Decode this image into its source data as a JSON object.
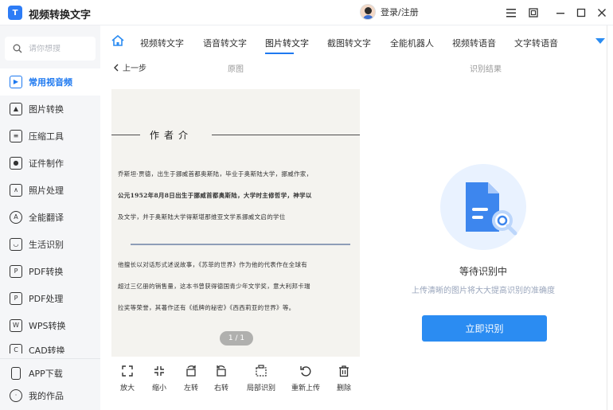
{
  "app": {
    "title": "视频转换文字",
    "logo_text": "T",
    "login_label": "登录/注册"
  },
  "window_controls": [
    "menu-icon",
    "restore-icon",
    "minimize-icon",
    "maximize-icon",
    "close-icon"
  ],
  "sidebar": {
    "search_placeholder": "请你想搜",
    "items": [
      {
        "label": "常用视音频",
        "icon": "tv-icon",
        "active": true
      },
      {
        "label": "图片转换",
        "icon": "image-icon"
      },
      {
        "label": "压缩工具",
        "icon": "compress-icon"
      },
      {
        "label": "证件制作",
        "icon": "id-photo-icon"
      },
      {
        "label": "照片处理",
        "icon": "photo-icon"
      },
      {
        "label": "全能翻译",
        "icon": "translate-icon"
      },
      {
        "label": "生活识别",
        "icon": "cup-icon"
      },
      {
        "label": "PDF转换",
        "icon": "pdf-convert-icon"
      },
      {
        "label": "PDF处理",
        "icon": "pdf-process-icon"
      },
      {
        "label": "WPS转换",
        "icon": "wps-icon"
      },
      {
        "label": "CAD转换",
        "icon": "cad-icon"
      }
    ],
    "bottom": [
      {
        "label": "APP下载",
        "icon": "phone-icon"
      },
      {
        "label": "我的作品",
        "icon": "works-icon"
      }
    ]
  },
  "tabs": [
    {
      "label": "视频转文字"
    },
    {
      "label": "语音转文字"
    },
    {
      "label": "图片转文字",
      "active": true
    },
    {
      "label": "截图转文字"
    },
    {
      "label": "全能机器人"
    },
    {
      "label": "视频转语音"
    },
    {
      "label": "文字转语音"
    }
  ],
  "subheader": {
    "back_label": "上一步",
    "original_label": "原图",
    "result_label": "识别结果"
  },
  "document": {
    "heading": "作者介",
    "lines_top": [
      "乔斯坦·贾德，出生于挪威首都奥斯陆，毕业于奥斯陆大学，挪威作家，",
      "公元1952年8月8日出生于挪威首都奥斯陆，大学时主修哲学，神学以",
      "及文学，并于奥斯陆大学得斯堪那维亚文学系挪威文启的学位"
    ],
    "lines_bottom": [
      "他擅长以对话形式述说故事，《苏菲的世界》作为他的代表作在全球有",
      "超过三亿册的销售量，这本书曾获得德国青少年文学奖，意大利邦卡瑞",
      "拉奖等荣誉，其著作还有《纸牌的秘密》《西西莉亚的世界》等。"
    ],
    "page_indicator": "1 / 1"
  },
  "toolbar": [
    {
      "label": "放大",
      "icon": "zoom-in-icon"
    },
    {
      "label": "缩小",
      "icon": "zoom-out-icon"
    },
    {
      "label": "左转",
      "icon": "rotate-left-icon"
    },
    {
      "label": "右转",
      "icon": "rotate-right-icon"
    },
    {
      "label": "局部识别",
      "icon": "crop-icon"
    },
    {
      "label": "重新上传",
      "icon": "reupload-icon"
    },
    {
      "label": "删除",
      "icon": "trash-icon"
    }
  ],
  "result": {
    "status_title": "等待识别中",
    "status_subtitle": "上传清晰的图片将大大提高识别的准确度",
    "button_label": "立即识别"
  },
  "colors": {
    "accent": "#2b8cf2",
    "sidebar_bg": "#f5f6f8",
    "illustration_bg": "#e9f2ff"
  }
}
